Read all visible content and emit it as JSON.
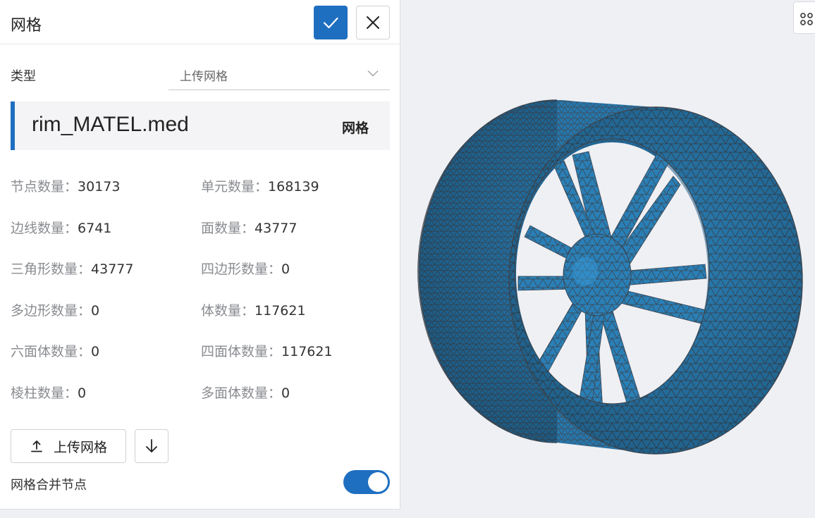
{
  "panel": {
    "title": "网格",
    "confirm_icon": "check-icon",
    "close_icon": "close-icon"
  },
  "type": {
    "label": "类型",
    "value": "上传网格"
  },
  "file": {
    "name": "rim_MATEL.med",
    "tag": "网格"
  },
  "stats": [
    {
      "key": "节点数量：",
      "value": "30173"
    },
    {
      "key": "单元数量：",
      "value": "168139"
    },
    {
      "key": "边线数量：",
      "value": "6741"
    },
    {
      "key": "面数量：",
      "value": "43777"
    },
    {
      "key": "三角形数量：",
      "value": "43777"
    },
    {
      "key": "四边形数量：",
      "value": "0"
    },
    {
      "key": "多边形数量：",
      "value": "0"
    },
    {
      "key": "体数量：",
      "value": "117621"
    },
    {
      "key": "六面体数量：",
      "value": "0"
    },
    {
      "key": "四面体数量：",
      "value": "117621"
    },
    {
      "key": "棱柱数量：",
      "value": "0"
    },
    {
      "key": "多面体数量：",
      "value": "0"
    }
  ],
  "actions": {
    "upload_label": "上传网格",
    "upload_icon": "upload-icon",
    "download_icon": "download-arrow-icon"
  },
  "merge_nodes": {
    "label": "网格合并节点",
    "enabled": true
  },
  "colors": {
    "accent": "#1f6fc1",
    "mesh_fill": "#2a7fb6",
    "mesh_edge": "#3d4650",
    "background": "#eff0f4"
  }
}
